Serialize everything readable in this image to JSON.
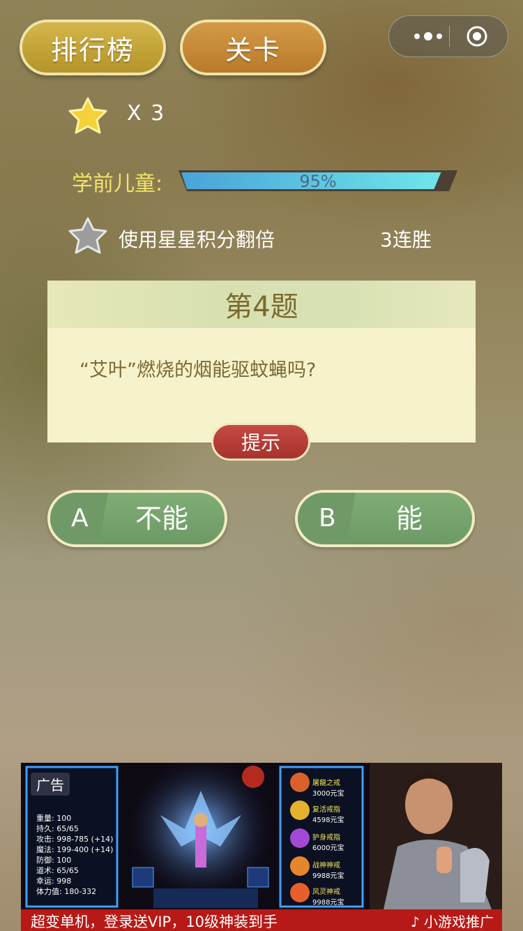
{
  "header": {
    "ranking_label": "排行榜",
    "level_label": "关卡"
  },
  "stars": {
    "count_text": "X 3"
  },
  "grade": {
    "label": "学前儿童:",
    "progress_text": "95%",
    "progress_value": 0.95
  },
  "bonus": {
    "double_label": "使用星星积分翻倍",
    "streak": "3连胜"
  },
  "question": {
    "title": "第4题",
    "text": "“艾叶”燃烧的烟能驱蚊蝇吗?",
    "hint_label": "提示"
  },
  "answers": [
    {
      "letter": "A",
      "text": "不能"
    },
    {
      "letter": "B",
      "text": "能"
    }
  ],
  "ad": {
    "label": "广告",
    "slogan": "超变单机，登录送VIP，10级神装到手",
    "promo": "小游戏推广",
    "stats": [
      "重量: 100",
      "持久: 65/65",
      "攻击: 998-785 (+14)",
      "魔法: 199-400 (+14)",
      "防御: 100",
      "道术: 65/65",
      "幸运: 998",
      "体力值: 180-332"
    ],
    "items": [
      {
        "name": "屠龍之戒",
        "price": "3000元宝"
      },
      {
        "name": "复活戒指",
        "price": "4598元宝"
      },
      {
        "name": "护身戒指",
        "price": "6000元宝"
      },
      {
        "name": "战神神戒",
        "price": "9988元宝"
      },
      {
        "name": "风灵神戒",
        "price": "9988元宝"
      }
    ]
  },
  "colors": {
    "grade_label": "#f2e46a",
    "answer_green": "#7aa871",
    "hint_red": "#b63c37",
    "progress_fill": "#5fd2e8"
  }
}
